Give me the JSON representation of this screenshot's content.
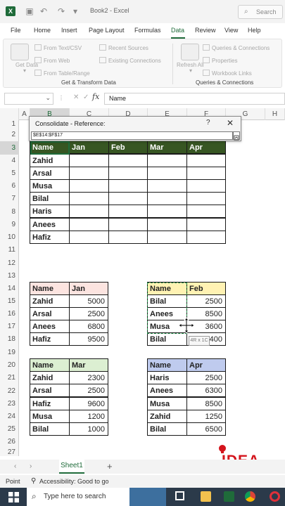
{
  "titlebar": {
    "title": "Book2 - Excel",
    "search_placeholder": "Search"
  },
  "tabs": [
    "File",
    "Home",
    "Insert",
    "Page Layout",
    "Formulas",
    "Data",
    "Review",
    "View",
    "Help"
  ],
  "active_tab": "Data",
  "ribbon": {
    "get_data": "Get Data",
    "get_data_arrow": "▾",
    "from_text_csv": "From Text/CSV",
    "from_web": "From Web",
    "from_table_range": "From Table/Range",
    "recent_sources": "Recent Sources",
    "existing_connections": "Existing Connections",
    "group_get_transform": "Get & Transform Data",
    "refresh_all": "Refresh All",
    "refresh_arrow": "▾",
    "queries_connections": "Queries & Connections",
    "properties": "Properties",
    "workbook_links": "Workbook Links",
    "group_queries": "Queries & Connections"
  },
  "formula_bar": {
    "name_box": "",
    "fx": "fx",
    "content": "Name"
  },
  "columns": [
    "A",
    "B",
    "C",
    "D",
    "E",
    "F",
    "G",
    "H"
  ],
  "rows": [
    "1",
    "2",
    "3",
    "4",
    "5",
    "6",
    "7",
    "8",
    "9",
    "10",
    "11",
    "12",
    "13",
    "14",
    "15",
    "16",
    "17",
    "18",
    "19",
    "20",
    "21",
    "22",
    "23",
    "24",
    "25",
    "26",
    "27"
  ],
  "dialog": {
    "title": "Consolidate - Reference:",
    "help": "?",
    "close": "✕",
    "reference": "$E$14:$F$17"
  },
  "main_table": {
    "headers": [
      "Name",
      "Jan",
      "Feb",
      "Mar",
      "Apr"
    ],
    "names": [
      "Zahid",
      "Arsal",
      "Musa",
      "Bilal",
      "Haris",
      "Anees",
      "Hafiz"
    ]
  },
  "jan_table": {
    "headers": [
      "Name",
      "Jan"
    ],
    "rows": [
      [
        "Zahid",
        "5000"
      ],
      [
        "Arsal",
        "2500"
      ],
      [
        "Anees",
        "6800"
      ],
      [
        "Hafiz",
        "9500"
      ]
    ]
  },
  "feb_table": {
    "headers": [
      "Name",
      "Feb"
    ],
    "rows": [
      [
        "Bilal",
        "2500"
      ],
      [
        "Anees",
        "8500"
      ],
      [
        "Musa",
        "3600"
      ],
      [
        "Bilal",
        "400"
      ]
    ]
  },
  "mar_table": {
    "headers": [
      "Name",
      "Mar"
    ],
    "rows": [
      [
        "Zahid",
        "2300"
      ],
      [
        "Arsal",
        "2500"
      ],
      [
        "Hafiz",
        "9600"
      ],
      [
        "Musa",
        "1200"
      ],
      [
        "Bilal",
        "1000"
      ]
    ]
  },
  "apr_table": {
    "headers": [
      "Name",
      "Apr"
    ],
    "rows": [
      [
        "Haris",
        "2500"
      ],
      [
        "Anees",
        "6300"
      ],
      [
        "Musa",
        "8500"
      ],
      [
        "Zahid",
        "1250"
      ],
      [
        "Bilal",
        "6500"
      ]
    ]
  },
  "selection_tooltip": "4R x 1C",
  "sheet_tab": "Sheet1",
  "status": {
    "mode": "Point",
    "accessibility": "Accessibility: Good to go"
  },
  "taskbar": {
    "search_placeholder": "Type here to search"
  },
  "watermark": "IDEA",
  "colors": {
    "excel_green": "#1f6b3a",
    "header_dark_green": "#375623",
    "pink": "#fce4e0",
    "yellow": "#fff2b3",
    "light_green": "#dcefd2",
    "blue": "#bfcbee",
    "idea_red": "#d4141c"
  }
}
